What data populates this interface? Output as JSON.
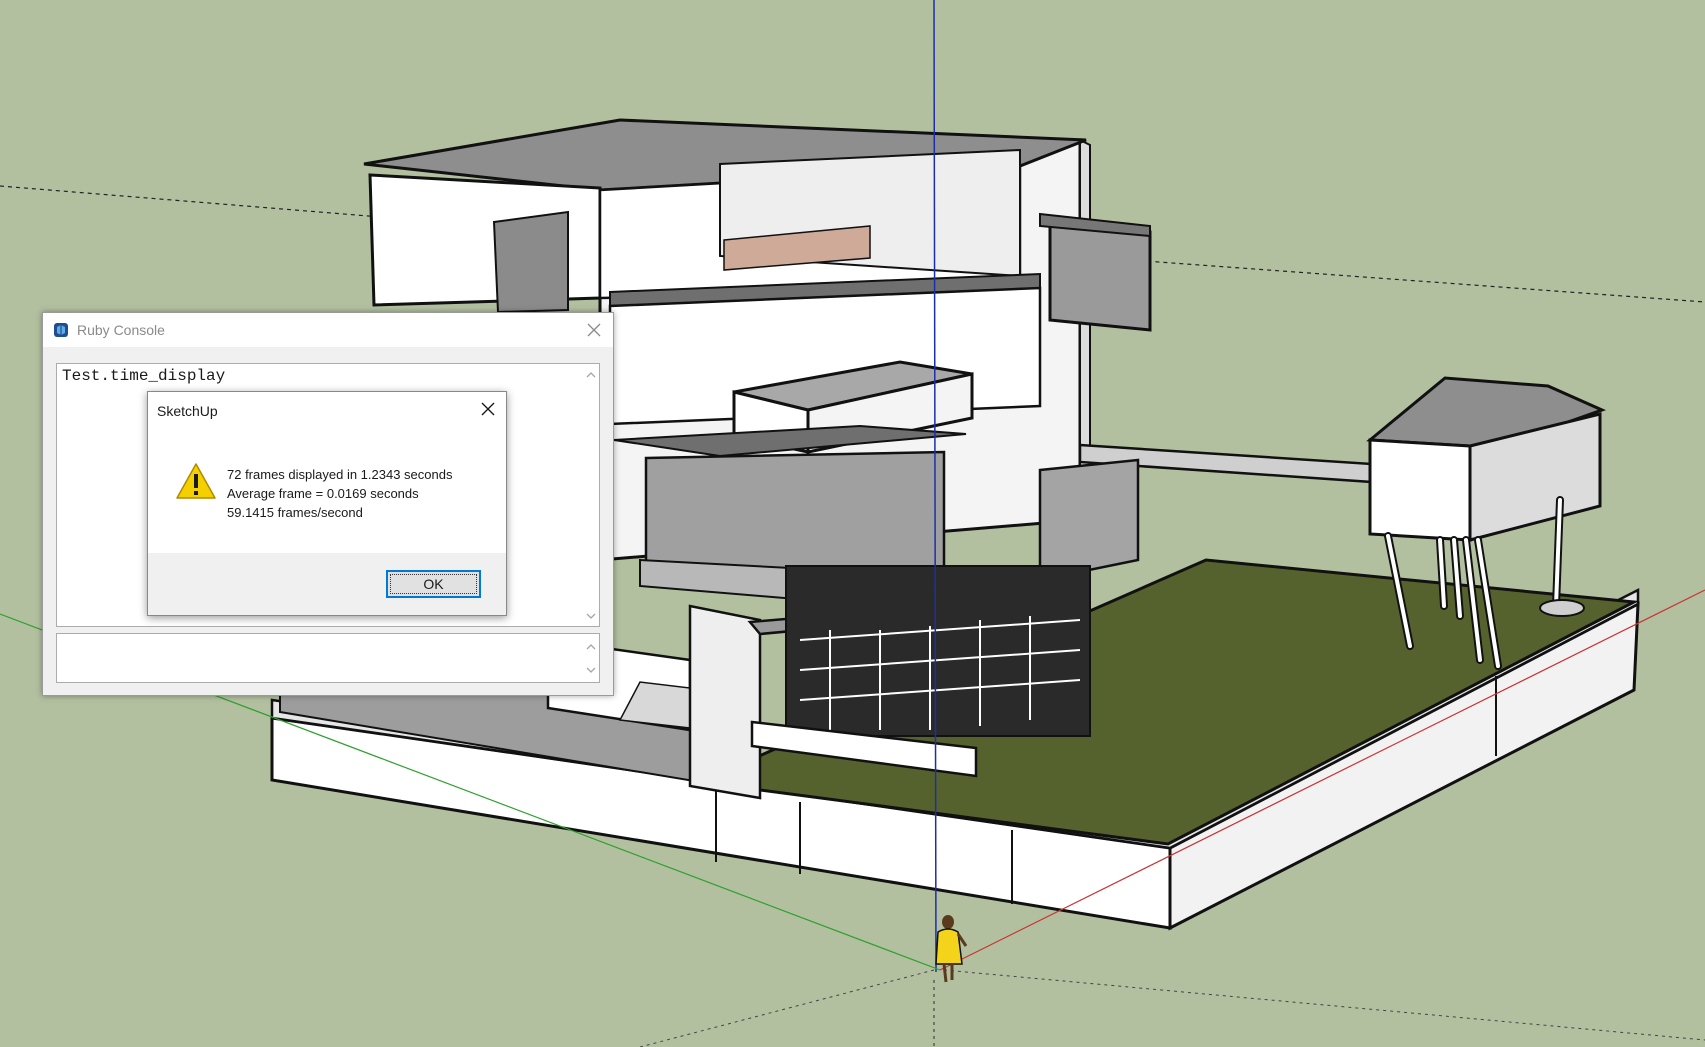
{
  "viewport": {
    "background": "#b2c0a0",
    "axis_colors": {
      "red": "#c83232",
      "green": "#2ea02e",
      "blue": "#1e2ea8"
    },
    "grass_color": "#56622e"
  },
  "ruby_console": {
    "title": "Ruby Console",
    "app_icon": "sketchup-icon",
    "close_icon": "close-icon",
    "output_text": "Test.time_display",
    "input_value": ""
  },
  "message_box": {
    "title": "SketchUp",
    "icon": "warning-icon",
    "lines": [
      "72 frames displayed in 1.2343 seconds",
      "Average frame = 0.0169 seconds",
      "59.1415 frames/second"
    ],
    "ok_label": "OK",
    "close_icon": "close-icon"
  }
}
